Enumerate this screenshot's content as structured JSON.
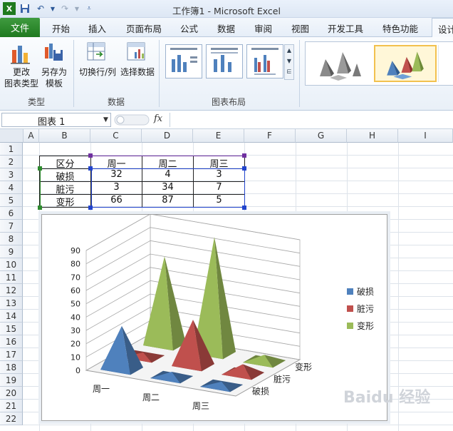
{
  "window": {
    "title": "工作簿1 - Microsoft Excel"
  },
  "ribbon_tabs": {
    "file": "文件",
    "items": [
      "开始",
      "插入",
      "页面布局",
      "公式",
      "数据",
      "审阅",
      "视图",
      "开发工具",
      "特色功能"
    ],
    "active": "设计"
  },
  "ribbon": {
    "type_group": {
      "label": "类型",
      "change_type_line1": "更改",
      "change_type_line2": "图表类型",
      "save_template_line1": "另存为",
      "save_template_line2": "模板"
    },
    "data_group": {
      "label": "数据",
      "switch": "切换行/列",
      "select": "选择数据"
    },
    "layout_group": {
      "label": "图表布局"
    }
  },
  "formula_bar": {
    "name_box": "图表 1",
    "fx": "fx",
    "value": ""
  },
  "sheet": {
    "columns": [
      "A",
      "B",
      "C",
      "D",
      "E",
      "F",
      "G",
      "H",
      "I"
    ],
    "rows": [
      "1",
      "2",
      "3",
      "4",
      "5",
      "6",
      "7",
      "8",
      "9",
      "10",
      "11",
      "12",
      "13",
      "14",
      "15",
      "16",
      "17",
      "18",
      "19",
      "20",
      "21",
      "22"
    ],
    "table": {
      "header": [
        "区分",
        "周一",
        "周二",
        "周三"
      ],
      "rows": [
        [
          "破损",
          "32",
          "4",
          "3"
        ],
        [
          "脏污",
          "3",
          "34",
          "7"
        ],
        [
          "变形",
          "66",
          "87",
          "5"
        ]
      ]
    }
  },
  "chart_data": {
    "type": "bar",
    "variant": "3d-pyramid",
    "categories": [
      "周一",
      "周二",
      "周三"
    ],
    "series": [
      {
        "name": "破损",
        "values": [
          32,
          4,
          3
        ],
        "color": "#4f81bd"
      },
      {
        "name": "脏污",
        "values": [
          3,
          34,
          7
        ],
        "color": "#c0504d"
      },
      {
        "name": "变形",
        "values": [
          66,
          87,
          5
        ],
        "color": "#9bbb59"
      }
    ],
    "depth_labels": [
      "破损",
      "脏污",
      "变形"
    ],
    "y_ticks": [
      "0",
      "10",
      "20",
      "30",
      "40",
      "50",
      "60",
      "70",
      "80",
      "90"
    ],
    "ylim": [
      0,
      90
    ],
    "legend_position": "right",
    "grid": true
  },
  "watermark": "Baidu 经验"
}
